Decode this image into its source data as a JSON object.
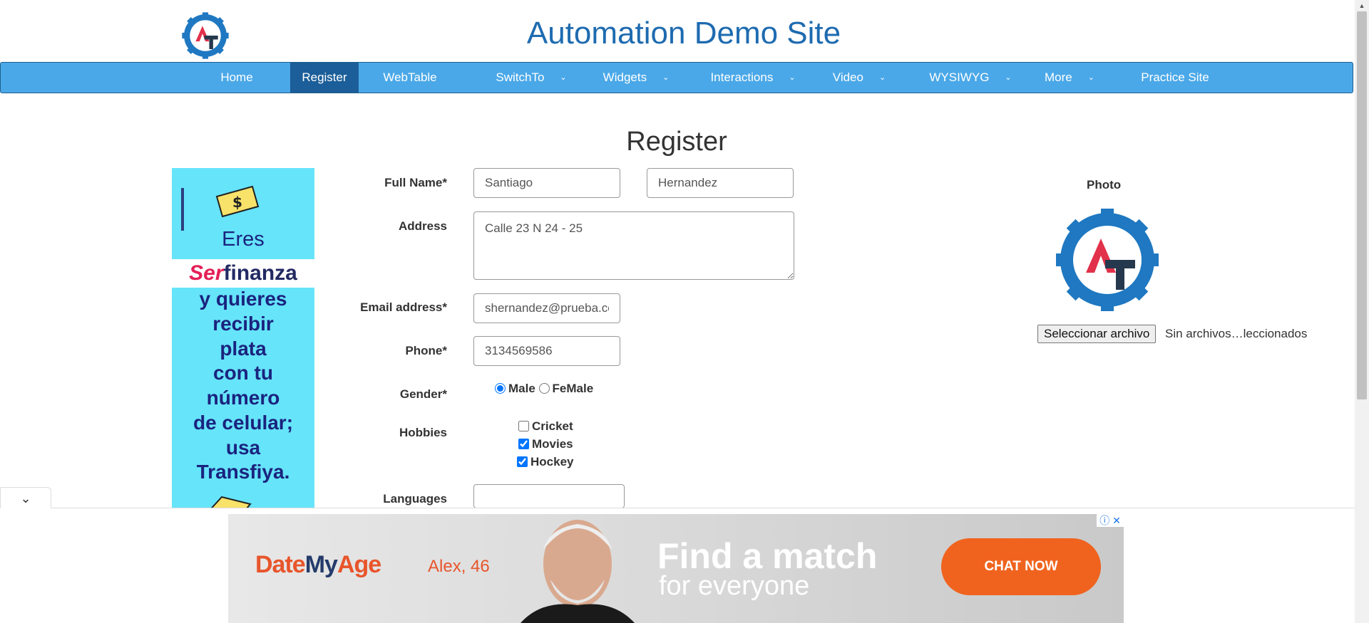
{
  "header": {
    "title": "Automation Demo Site"
  },
  "nav": {
    "items": [
      {
        "label": "Home",
        "active": false,
        "has_dropdown": false
      },
      {
        "label": "Register",
        "active": true,
        "has_dropdown": false
      },
      {
        "label": "WebTable",
        "active": false,
        "has_dropdown": false
      },
      {
        "label": "SwitchTo",
        "active": false,
        "has_dropdown": true
      },
      {
        "label": "Widgets",
        "active": false,
        "has_dropdown": true
      },
      {
        "label": "Interactions",
        "active": false,
        "has_dropdown": true
      },
      {
        "label": "Video",
        "active": false,
        "has_dropdown": true
      },
      {
        "label": "WYSIWYG",
        "active": false,
        "has_dropdown": true
      },
      {
        "label": "More",
        "active": false,
        "has_dropdown": true
      },
      {
        "label": "Practice Site",
        "active": false,
        "has_dropdown": false
      }
    ],
    "chevron": "⌄"
  },
  "page": {
    "title": "Register"
  },
  "form": {
    "full_name_label": "Full Name*",
    "first_name": "Santiago",
    "last_name": "Hernandez",
    "address_label": "Address",
    "address": "Calle 23 N 24 - 25",
    "email_label": "Email address*",
    "email": "shernandez@prueba.com",
    "phone_label": "Phone*",
    "phone": "3134569586",
    "gender_label": "Gender*",
    "gender_options": [
      "Male",
      "FeMale"
    ],
    "gender_selected": "Male",
    "hobbies_label": "Hobbies",
    "hobbies": [
      {
        "label": "Cricket",
        "checked": false
      },
      {
        "label": "Movies",
        "checked": true
      },
      {
        "label": "Hockey",
        "checked": true
      }
    ],
    "languages_label": "Languages"
  },
  "photo": {
    "label": "Photo",
    "button_label": "Seleccionar archivo",
    "status": "Sin archivos…leccionados"
  },
  "side_ad": {
    "line1": "Eres",
    "brand_ser": "Ser",
    "brand_rest": "finanza",
    "lines": [
      "y quieres",
      "recibir",
      "plata",
      "con tu",
      "número",
      "de celular;",
      "usa",
      "Transfiya."
    ]
  },
  "bottom_ad": {
    "brand_date": "Date",
    "brand_my": "My",
    "brand_age": "Age",
    "name": "Alex, 46",
    "headline": "Find a match",
    "subline": "for everyone",
    "cta": "CHAT NOW",
    "close_icons": "ⓘ ✕"
  },
  "colors": {
    "nav_bg": "#4aa8e8",
    "nav_active": "#1b5e99",
    "title_blue": "#1e6bb0",
    "logo_blue": "#1f78c1",
    "logo_red": "#e2314a",
    "logo_dark": "#25384d",
    "ad_cyan": "#66e4fa",
    "cta_orange": "#f0631e"
  }
}
